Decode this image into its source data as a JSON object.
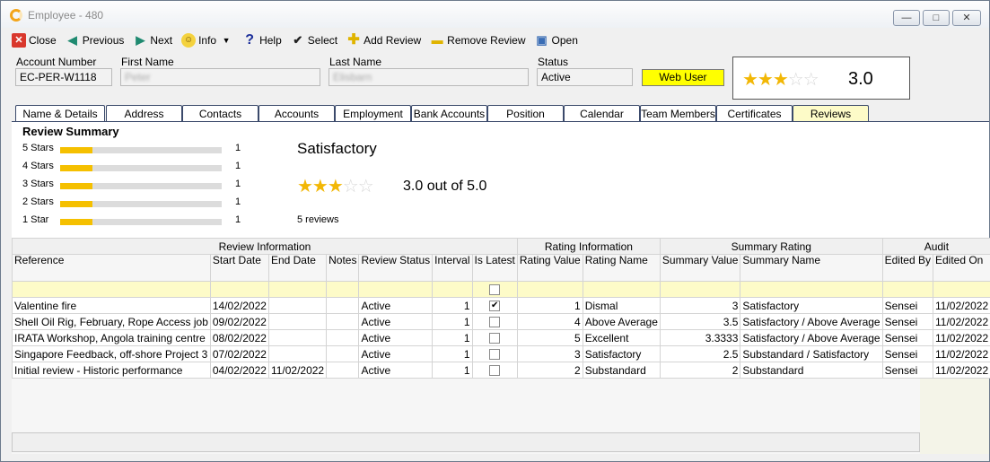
{
  "window": {
    "title": "Employee - 480"
  },
  "toolbar": {
    "close": "Close",
    "previous": "Previous",
    "next": "Next",
    "info": "Info",
    "help": "Help",
    "select": "Select",
    "add_review": "Add Review",
    "remove_review": "Remove Review",
    "open": "Open"
  },
  "header": {
    "account_number_label": "Account Number",
    "account_number": "EC-PER-W1118",
    "first_name_label": "First Name",
    "first_name": "Peter",
    "last_name_label": "Last Name",
    "last_name": "Elisbarn",
    "status_label": "Status",
    "status": "Active",
    "web_user": "Web User",
    "rating_stars": "★★★☆☆",
    "rating_value": "3.0"
  },
  "tabs": [
    "Name & Details",
    "Address",
    "Contacts",
    "Accounts",
    "Employment",
    "Bank Accounts",
    "Position",
    "Calendar",
    "Team Members",
    "Certificates",
    "Reviews"
  ],
  "active_tab": "Reviews",
  "summary": {
    "title": "Review Summary",
    "rows": [
      {
        "label": "5 Stars",
        "count": "1",
        "fraction": 0.2
      },
      {
        "label": "4 Stars",
        "count": "1",
        "fraction": 0.2
      },
      {
        "label": "3 Stars",
        "count": "1",
        "fraction": 0.2
      },
      {
        "label": "2 Stars",
        "count": "1",
        "fraction": 0.2
      },
      {
        "label": "1 Star",
        "count": "1",
        "fraction": 0.2
      }
    ],
    "rating_label": "Satisfactory",
    "out_of": "3.0 out of 5.0",
    "reviews_count": "5 reviews"
  },
  "grid": {
    "groups": [
      {
        "label": "Review Information",
        "span": 8
      },
      {
        "label": "Rating Information",
        "span": 2
      },
      {
        "label": "Summary Rating",
        "span": 2
      },
      {
        "label": "Audit",
        "span": 2
      }
    ],
    "columns": [
      "Reference",
      "Start Date",
      "End Date",
      "Notes",
      "Review Status",
      "Interval",
      "Is Latest",
      "Rating Value",
      "Rating Name",
      "Summary Value",
      "Summary Name",
      "Edited By",
      "Edited On"
    ],
    "rows": [
      {
        "reference": "Valentine fire",
        "start": "14/02/2022",
        "end": "",
        "notes": "",
        "status": "Active",
        "interval": "1",
        "latest": true,
        "rating_value": "1",
        "rating_name": "Dismal",
        "summary_value": "3",
        "summary_name": "Satisfactory",
        "edited_by": "Sensei",
        "edited_on": "11/02/2022"
      },
      {
        "reference": "Shell Oil Rig, February, Rope Access job",
        "start": "09/02/2022",
        "end": "",
        "notes": "",
        "status": "Active",
        "interval": "1",
        "latest": false,
        "rating_value": "4",
        "rating_name": "Above Average",
        "summary_value": "3.5",
        "summary_name": "Satisfactory / Above Average",
        "edited_by": "Sensei",
        "edited_on": "11/02/2022"
      },
      {
        "reference": "IRATA Workshop, Angola training centre",
        "start": "08/02/2022",
        "end": "",
        "notes": "",
        "status": "Active",
        "interval": "1",
        "latest": false,
        "rating_value": "5",
        "rating_name": "Excellent",
        "summary_value": "3.3333",
        "summary_name": "Satisfactory / Above Average",
        "edited_by": "Sensei",
        "edited_on": "11/02/2022"
      },
      {
        "reference": "Singapore Feedback, off-shore Project 3",
        "start": "07/02/2022",
        "end": "",
        "notes": "",
        "status": "Active",
        "interval": "1",
        "latest": false,
        "rating_value": "3",
        "rating_name": "Satisfactory",
        "summary_value": "2.5",
        "summary_name": "Substandard / Satisfactory",
        "edited_by": "Sensei",
        "edited_on": "11/02/2022"
      },
      {
        "reference": "Initial review - Historic performance",
        "start": "04/02/2022",
        "end": "11/02/2022",
        "notes": "",
        "status": "Active",
        "interval": "1",
        "latest": false,
        "rating_value": "2",
        "rating_name": "Substandard",
        "summary_value": "2",
        "summary_name": "Substandard",
        "edited_by": "Sensei",
        "edited_on": "11/02/2022"
      }
    ]
  },
  "colors": {
    "accent_yellow": "#ffff00",
    "star": "#f2b705",
    "bar": "#f5c000",
    "tab_active": "#fdfbc8"
  }
}
